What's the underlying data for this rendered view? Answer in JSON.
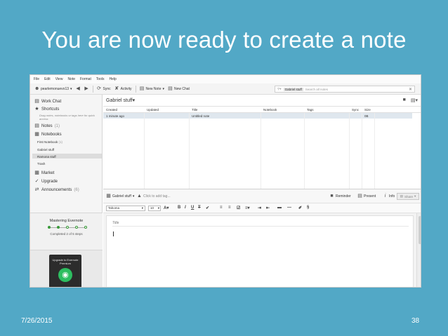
{
  "slide": {
    "title": "You are now ready to create a note",
    "date": "7/26/2015",
    "page": "38"
  },
  "app": {
    "menu": [
      "File",
      "Edit",
      "View",
      "Note",
      "Format",
      "Tools",
      "Help"
    ],
    "toolbar": {
      "account": "pearlemonuevo13",
      "sync": "Sync",
      "activity": "Activity",
      "new_note": "New Note",
      "new_chat": "New Chat"
    },
    "search": {
      "tag": "Gabriel stuff",
      "placeholder": "Search all notes"
    },
    "sidebar": {
      "work_chat": "Work Chat",
      "shortcuts": "Shortcuts",
      "shortcuts_hint": "Drag notes, notebooks or tags here for quick access",
      "notes": "Notes",
      "notes_count": "(1)",
      "notebooks": "Notebooks",
      "notebook_items": [
        {
          "label": "First Notebook",
          "count": "(1)"
        },
        {
          "label": "Gabriel stuff",
          "count": ""
        },
        {
          "label": "Ramona stuff",
          "count": ""
        },
        {
          "label": "Trash",
          "count": ""
        }
      ],
      "market": "Market",
      "upgrade": "Upgrade",
      "announcements": "Announcements",
      "announcements_count": "(6)",
      "mastering_title": "Mastering Evernote",
      "mastering_progress": "Completed 2 of 5 steps",
      "steps_total": 5,
      "steps_done": 2,
      "promo_text": "Upgrade to Evernote Premium"
    },
    "list": {
      "notebook_title": "Gabriel stuff",
      "columns": [
        "Created",
        "Updated",
        "Title",
        "Notebook",
        "Tags",
        "Sync",
        "Size"
      ],
      "rows": [
        {
          "created": "1 minute ago",
          "updated": "",
          "title": "Untitled note",
          "notebook": "",
          "tags": "",
          "sync": "",
          "size": "0B"
        }
      ]
    },
    "editor": {
      "notebook": "Gabriel stuff",
      "tag_placeholder": "Click to add tag...",
      "reminder": "Reminder",
      "present": "Present",
      "info": "Info",
      "share": "Share",
      "font": "Tahoma",
      "font_size": "10",
      "title_placeholder": "Title"
    }
  }
}
